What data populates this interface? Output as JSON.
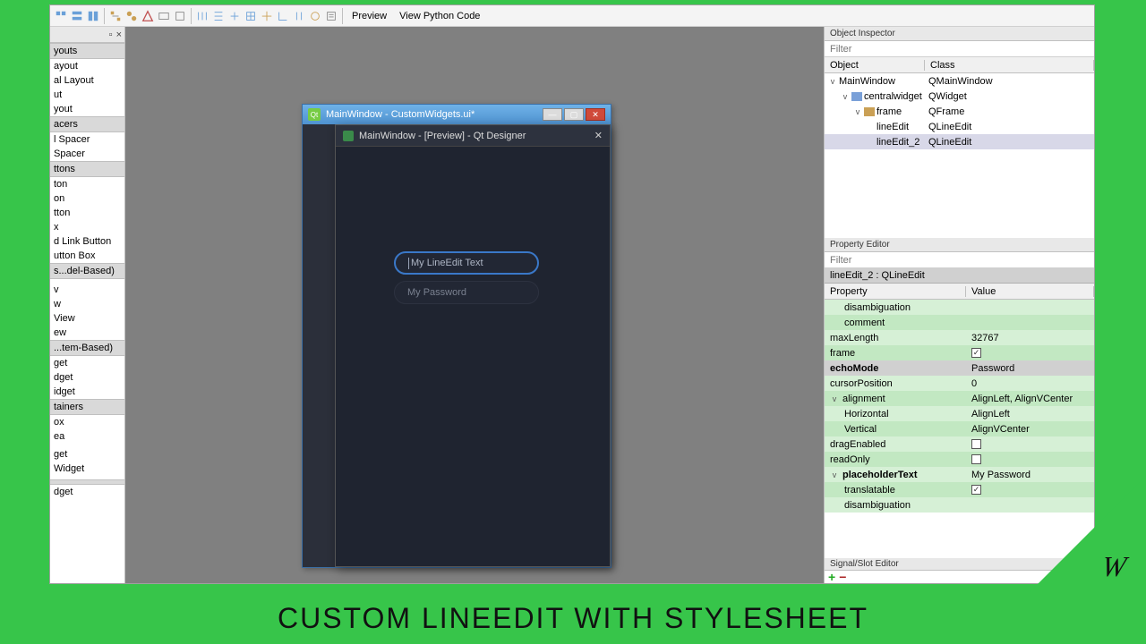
{
  "toolbar": {
    "preview": "Preview",
    "viewcode": "View Python Code"
  },
  "widgetbox": {
    "header": "  ",
    "items": [
      {
        "t": "youts",
        "cat": true
      },
      {
        "t": "ayout"
      },
      {
        "t": "al Layout"
      },
      {
        "t": "ut"
      },
      {
        "t": "yout"
      },
      {
        "t": "acers",
        "cat": true
      },
      {
        "t": "l Spacer"
      },
      {
        "t": "Spacer"
      },
      {
        "t": "ttons",
        "cat": true
      },
      {
        "t": "ton"
      },
      {
        "t": "on"
      },
      {
        "t": "tton"
      },
      {
        "t": "x"
      },
      {
        "t": "d Link Button"
      },
      {
        "t": "utton Box"
      },
      {
        "t": "s...del-Based)",
        "cat": true
      },
      {
        "t": ""
      },
      {
        "t": "v"
      },
      {
        "t": "w"
      },
      {
        "t": "View"
      },
      {
        "t": "ew"
      },
      {
        "t": "...tem-Based)",
        "cat": true
      },
      {
        "t": "get"
      },
      {
        "t": "dget"
      },
      {
        "t": "idget"
      },
      {
        "t": "tainers",
        "cat": true
      },
      {
        "t": "ox"
      },
      {
        "t": "ea"
      },
      {
        "t": ""
      },
      {
        "t": "get"
      },
      {
        "t": "Widget"
      },
      {
        "t": ""
      },
      {
        "t": "",
        "cat": true
      },
      {
        "t": "dget"
      }
    ]
  },
  "designer": {
    "title": "MainWindow - CustomWidgets.ui*",
    "preview_title": "MainWindow - [Preview] - Qt Designer",
    "line1_placeholder": "My LineEdit Text",
    "line2_placeholder": "My Password"
  },
  "objinsp": {
    "title": "Object Inspector",
    "filter": "Filter",
    "head_obj": "Object",
    "head_cls": "Class",
    "rows": [
      {
        "ind": 0,
        "exp": "v",
        "obj": "MainWindow",
        "cls": "QMainWindow"
      },
      {
        "ind": 1,
        "exp": "v",
        "obj": "centralwidget",
        "cls": "QWidget",
        "ico": "#7aa0d8"
      },
      {
        "ind": 2,
        "exp": "v",
        "obj": "frame",
        "cls": "QFrame",
        "ico": "#caa055"
      },
      {
        "ind": 3,
        "exp": "",
        "obj": "lineEdit",
        "cls": "QLineEdit"
      },
      {
        "ind": 3,
        "exp": "",
        "obj": "lineEdit_2",
        "cls": "QLineEdit",
        "sel": true
      }
    ]
  },
  "proped": {
    "title": "Property Editor",
    "filter": "Filter",
    "objline": "lineEdit_2 : QLineEdit",
    "head_p": "Property",
    "head_v": "Value",
    "rows": [
      {
        "p": "disambiguation",
        "v": "",
        "cls": "g1",
        "child": true
      },
      {
        "p": "comment",
        "v": "",
        "cls": "g2",
        "child": true
      },
      {
        "p": "maxLength",
        "v": "32767",
        "cls": "g1"
      },
      {
        "p": "frame",
        "v": "",
        "cls": "g2",
        "chk": true,
        "checked": true
      },
      {
        "p": "echoMode",
        "v": "Password",
        "cls": "sel",
        "bold": true
      },
      {
        "p": "cursorPosition",
        "v": "0",
        "cls": "g1"
      },
      {
        "p": "alignment",
        "v": "AlignLeft, AlignVCenter",
        "cls": "g2",
        "exp": "v"
      },
      {
        "p": "Horizontal",
        "v": "AlignLeft",
        "cls": "g1",
        "child": true
      },
      {
        "p": "Vertical",
        "v": "AlignVCenter",
        "cls": "g2",
        "child": true
      },
      {
        "p": "dragEnabled",
        "v": "",
        "cls": "g1",
        "chk": true,
        "checked": false
      },
      {
        "p": "readOnly",
        "v": "",
        "cls": "g2",
        "chk": true,
        "checked": false
      },
      {
        "p": "placeholderText",
        "v": "My Password",
        "cls": "g1",
        "exp": "v",
        "bold": true
      },
      {
        "p": "translatable",
        "v": "",
        "cls": "g2",
        "child": true,
        "chk": true,
        "checked": true
      },
      {
        "p": "disambiguation",
        "v": "",
        "cls": "g1",
        "child": true
      }
    ]
  },
  "sigslot": {
    "title": "Signal/Slot Editor"
  },
  "banner": "CUSTOM LINEEDIT WITH STYLESHEET",
  "logo": "W"
}
